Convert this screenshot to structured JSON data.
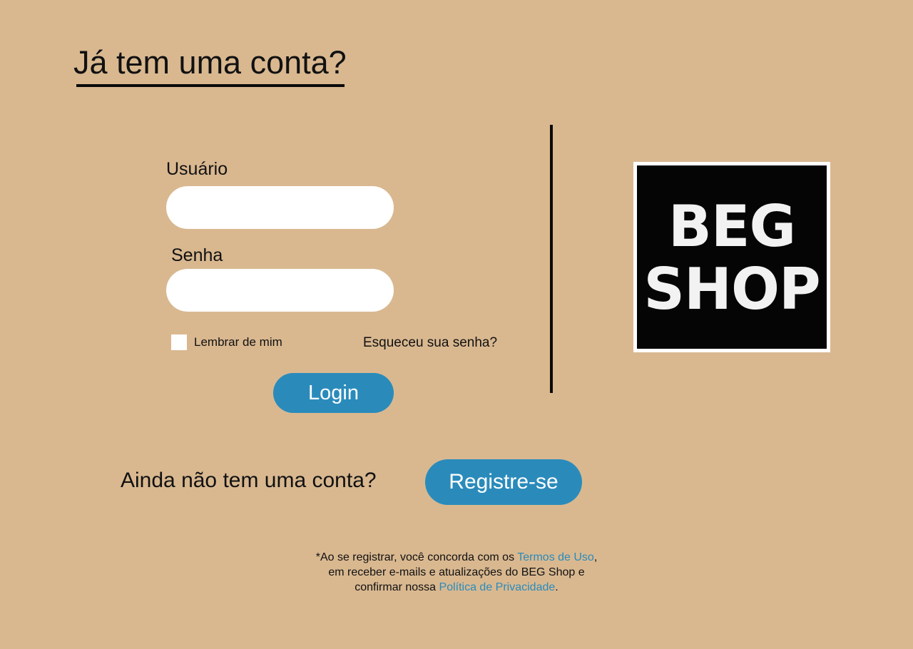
{
  "login": {
    "heading": "Já tem uma conta?",
    "username_label": "Usuário",
    "username_value": "",
    "password_label": "Senha",
    "password_value": "",
    "remember_label": "Lembrar de mim",
    "remember_checked": false,
    "forgot_link": "Esqueceu sua senha?",
    "login_button": "Login"
  },
  "brand": {
    "logo_line1": "BEG",
    "logo_line2": "SHOP"
  },
  "register": {
    "prompt": "Ainda não tem uma conta?",
    "button": "Registre-se"
  },
  "disclaimer": {
    "line1_text": "*Ao se registrar, você concorda com os ",
    "terms_link": "Termos de Uso",
    "line1_end": ",",
    "line2_text": "em receber e-mails e atualizações do BEG Shop e",
    "line3_text": "confirmar nossa ",
    "privacy_link": "Política de Privacidade",
    "line3_end": "."
  },
  "colors": {
    "background": "#d9b890",
    "accent": "#2a8bbb",
    "input_background": "#ffffff",
    "divider": "#0a0a0a",
    "logo_background": "#050505"
  }
}
